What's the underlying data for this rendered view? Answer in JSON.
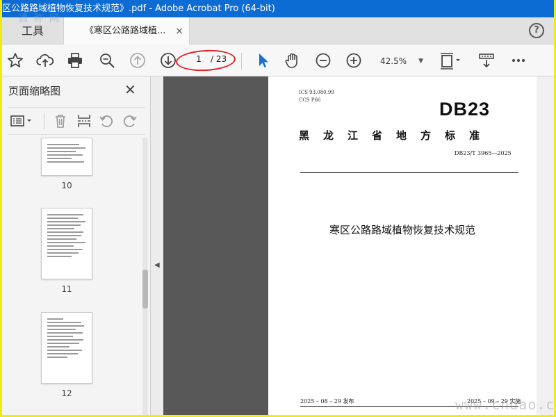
{
  "window": {
    "title": "区公路路域植物恢复技术规范》.pdf - Adobe Acrobat Pro (64-bit)"
  },
  "tabs": {
    "tools": "工具",
    "document": "《寒区公路路域植...",
    "close": "×",
    "help": "?"
  },
  "toolbar": {
    "current_page": "1",
    "total_pages": "/ 23",
    "zoom": "42.5%",
    "zoom_caret": "▼",
    "icons": [
      "star-icon",
      "upload-icon",
      "print-icon",
      "zoom-search-icon",
      "page-up-icon",
      "page-down-icon",
      "select-pointer-icon",
      "hand-icon",
      "zoom-out-icon",
      "zoom-in-icon",
      "fit-page-icon",
      "scroll-mode-icon",
      "more-icon"
    ]
  },
  "sidebar": {
    "title": "页面缩略图",
    "close": "✕",
    "thumbnails": [
      {
        "label": "10"
      },
      {
        "label": "11"
      },
      {
        "label": "12"
      }
    ],
    "collapse_arrow": "◀"
  },
  "document_page": {
    "ics": "ICS  93.080.99",
    "ccs": "CCS  P66",
    "standard_code": "DB23",
    "province": "黑龙江省地方标准",
    "standard_number": "DB23/T  3965—2025",
    "title": "寒区公路路域植物恢复技术规范",
    "published": "2025 – 08 – 29 发布",
    "implemented": "2025 – 09 – 29 实施"
  },
  "watermarks": {
    "top_left": "通 称 网",
    "bottom_right": "www.cndao.co"
  },
  "colors": {
    "titlebar": "#0d6bd4",
    "frame": "#f0ea1a",
    "doc_bg": "#575757",
    "highlight_oval": "#e0242b",
    "pointer_active": "#1a6fd1"
  }
}
